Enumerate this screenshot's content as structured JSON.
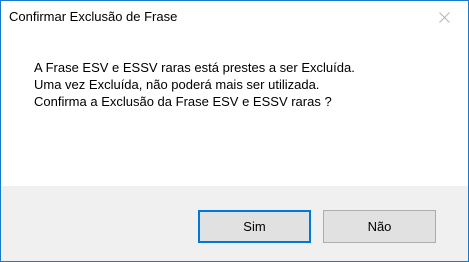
{
  "window": {
    "title": "Confirmar Exclusão de Frase",
    "close_glyph": "close-icon"
  },
  "message": {
    "lines": [
      "A Frase ESV e ESSV raras está prestes a ser Excluída.",
      "Uma vez Excluída, não poderá mais ser utilizada.",
      "Confirma a Exclusão da Frase ESV e ESSV raras ?"
    ]
  },
  "buttons": {
    "yes_label": "Sim",
    "no_label": "Não"
  },
  "colors": {
    "window_border": "#1979ca",
    "footer_bg": "#f0f0f0",
    "button_bg": "#e1e1e1",
    "default_button_border": "#0078d7"
  }
}
